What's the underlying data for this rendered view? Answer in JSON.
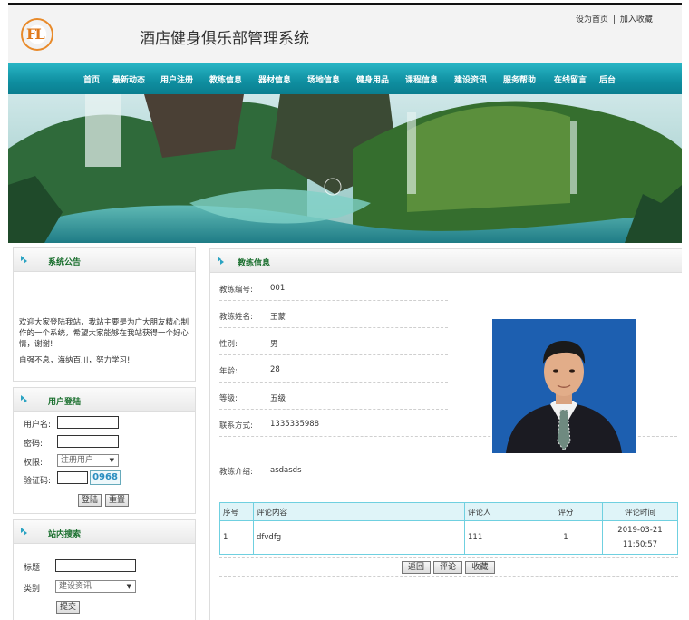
{
  "header": {
    "logo_text": "FL",
    "title": "酒店健身俱乐部管理系统",
    "links": [
      "设为首页",
      "加入收藏"
    ],
    "link_sep": "|"
  },
  "nav": [
    "首页",
    "最新动态",
    "用户注册",
    "教练信息",
    "器材信息",
    "场地信息",
    "健身用品",
    "课程信息",
    "建设资讯",
    "服务帮助",
    "在线留言",
    "后台"
  ],
  "notice": {
    "title": "系统公告",
    "text": "欢迎大家登陆我站，我站主要是为广大朋友精心制作的一个系统，希望大家能够在我站获得一个好心情，谢谢!",
    "text2": "自强不息，海纳百川，努力学习!"
  },
  "login": {
    "title": "用户登陆",
    "username_label": "用户名:",
    "password_label": "密码:",
    "role_label": "权限:",
    "role_value": "注册用户",
    "captcha_label": "验证码:",
    "captcha_code": "0968",
    "login_button": "登陆",
    "reset_button": "重置"
  },
  "search": {
    "title": "站内搜索",
    "title_label": "标题",
    "category_label": "类别",
    "category_value": "建设资讯",
    "submit_button": "提交"
  },
  "main": {
    "title": "教练信息",
    "fields": [
      {
        "label": "教练编号:",
        "value": "001"
      },
      {
        "label": "教练姓名:",
        "value": "王蒙"
      },
      {
        "label": "性别:",
        "value": "男"
      },
      {
        "label": "年龄:",
        "value": "28"
      },
      {
        "label": "等级:",
        "value": "五级"
      },
      {
        "label": "联系方式:",
        "value": "1335335988"
      }
    ],
    "intro_label": "教练介绍:",
    "intro_value": "asdasds",
    "table": {
      "headers": [
        "序号",
        "评论内容",
        "评论人",
        "评分",
        "评论时间"
      ],
      "rows": [
        [
          "1",
          "dfvdfg",
          "111",
          "1",
          "2019-03-21",
          "11:50:57"
        ]
      ]
    },
    "buttons": [
      "返回",
      "评论",
      "收藏"
    ]
  }
}
